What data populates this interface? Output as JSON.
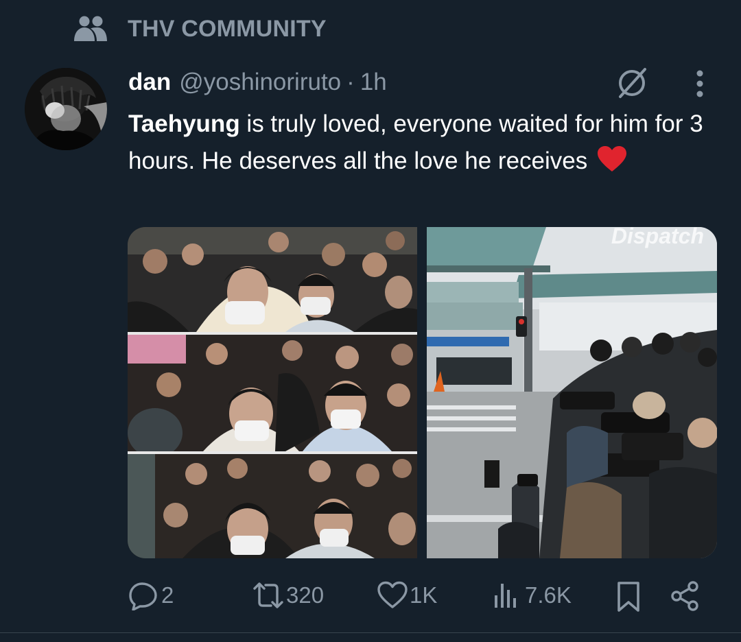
{
  "community": {
    "label": "THV COMMUNITY",
    "icon": "people-icon"
  },
  "tweet": {
    "author_name": "dan",
    "author_handle": "@yoshinoriruto",
    "separator": "·",
    "time": "1h",
    "text_bold": "Taehyung",
    "text_rest": " is truly loved, everyone waited for him for 3 hours. He deserves all the love he receives",
    "emoji": "red-heart-emoji",
    "media_watermark": "Dispatch"
  },
  "actions": {
    "replies": "2",
    "retweets": "320",
    "likes": "1K",
    "views": "7.6K"
  },
  "icons": {
    "reply": "reply-icon",
    "retweet": "retweet-icon",
    "like": "heart-icon",
    "views": "views-icon",
    "bookmark": "bookmark-icon",
    "share": "share-icon",
    "grok": "grok-icon",
    "more": "more-icon"
  },
  "colors": {
    "background": "#15202b",
    "secondary_text": "#8b98a5",
    "heart": "#e0242e"
  }
}
